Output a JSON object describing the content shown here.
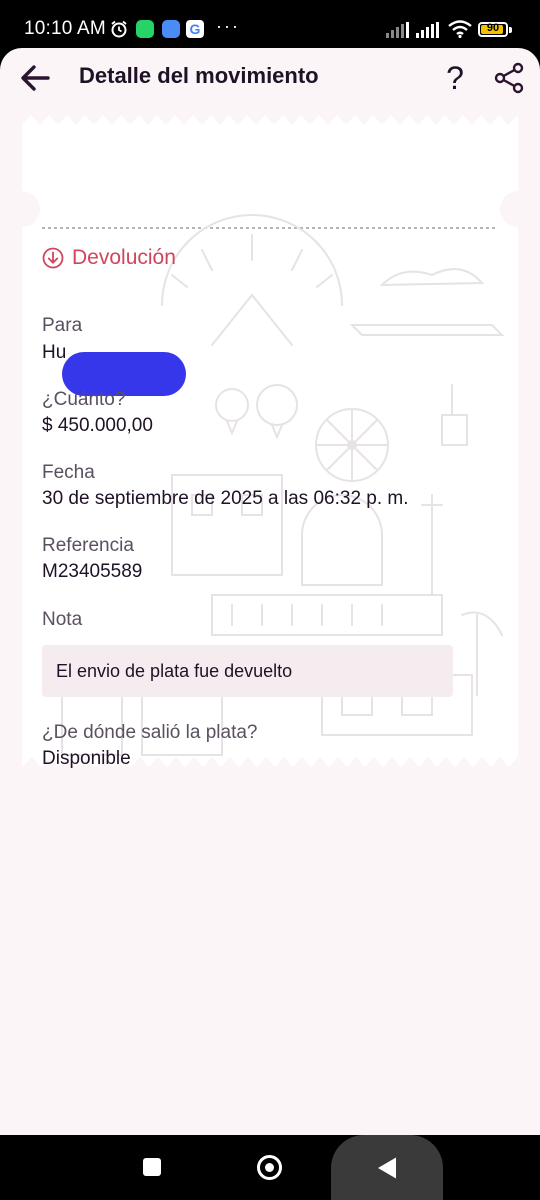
{
  "status_bar": {
    "time": "10:10 AM",
    "more": "···",
    "battery": "90",
    "icons": [
      "alarm-icon",
      "whatsapp-icon",
      "calendar-icon",
      "google-icon",
      "signal-icon",
      "signal-icon",
      "wifi-icon",
      "battery-icon"
    ],
    "battery_color": "#f2c200"
  },
  "header": {
    "title": "Detalle del movimiento",
    "icons": [
      "back-arrow-icon",
      "help-icon",
      "share-icon"
    ],
    "help_glyph": "?"
  },
  "receipt": {
    "type_label": "Devolución",
    "type_icon": "arrow-down-circle-icon",
    "accent_color": "#d0455e",
    "fields": {
      "recipient_label": "Para",
      "recipient_value": "Hu",
      "amount_label": "¿Cuánto?",
      "amount_value": "$ 450.000,00",
      "date_label": "Fecha",
      "date_value": "30 de septiembre de 2025 a las 06:32 p. m.",
      "reference_label": "Referencia",
      "reference_value": "M23405589",
      "note_label": "Nota",
      "note_value": "El envio de plata fue devuelto",
      "source_label": "¿De dónde salió la plata?",
      "source_value": "Disponible"
    }
  },
  "nav_bar": {
    "icons": [
      "recents-icon",
      "home-icon",
      "back-icon"
    ]
  }
}
